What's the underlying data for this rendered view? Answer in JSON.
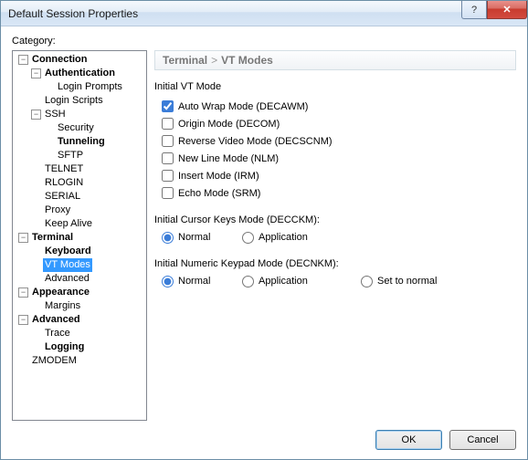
{
  "window": {
    "title": "Default Session Properties"
  },
  "category_label": "Category:",
  "breadcrumb": {
    "root": "Terminal",
    "sep": ">",
    "leaf": "VT Modes"
  },
  "tree": {
    "connection": "Connection",
    "authentication": "Authentication",
    "login_prompts": "Login Prompts",
    "login_scripts": "Login Scripts",
    "ssh": "SSH",
    "security": "Security",
    "tunneling": "Tunneling",
    "sftp": "SFTP",
    "telnet": "TELNET",
    "rlogin": "RLOGIN",
    "serial": "SERIAL",
    "proxy": "Proxy",
    "keep_alive": "Keep Alive",
    "terminal": "Terminal",
    "keyboard": "Keyboard",
    "vt_modes": "VT Modes",
    "advanced_term": "Advanced",
    "appearance": "Appearance",
    "margins": "Margins",
    "advanced": "Advanced",
    "trace": "Trace",
    "logging": "Logging",
    "zmodem": "ZMODEM"
  },
  "panel": {
    "initial_vt_mode": "Initial VT Mode",
    "chk_autowrap": "Auto Wrap Mode (DECAWM)",
    "chk_origin": "Origin Mode (DECOM)",
    "chk_reverse": "Reverse Video Mode (DECSCNM)",
    "chk_newline": "New Line Mode (NLM)",
    "chk_insert": "Insert Mode (IRM)",
    "chk_echo": "Echo Mode (SRM)",
    "cursor_label": "Initial Cursor Keys Mode (DECCKM):",
    "keypad_label": "Initial Numeric Keypad Mode (DECNKM):",
    "opt_normal": "Normal",
    "opt_application": "Application",
    "opt_set_normal": "Set to normal"
  },
  "buttons": {
    "ok": "OK",
    "cancel": "Cancel"
  },
  "exp": {
    "minus": "−",
    "plus": "+"
  }
}
